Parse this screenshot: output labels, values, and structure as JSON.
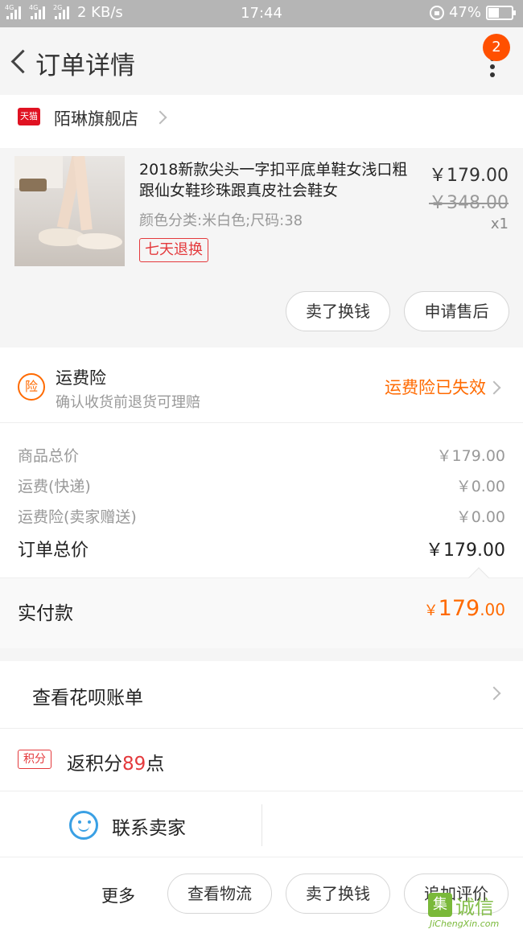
{
  "status_bar": {
    "network1": "4G",
    "network2": "4G",
    "network3": "2G",
    "speed": "2 KB/s",
    "time": "17:44",
    "battery": "47%",
    "battery_level": 0.47
  },
  "nav": {
    "title": "订单详情",
    "badge": "2"
  },
  "shop": {
    "logo_text": "天猫",
    "name": "陌琳旗舰店"
  },
  "product": {
    "title": "2018新款尖头一字扣平底单鞋女浅口粗跟仙女鞋珍珠跟真皮社会鞋女",
    "sku": "颜色分类:米白色;尺码:38",
    "tag": "七天退换",
    "price": "￥179.00",
    "original_price": "￥348.00",
    "quantity": "x1",
    "actions": [
      "卖了换钱",
      "申请售后"
    ]
  },
  "insurance": {
    "icon_text": "险",
    "title": "运费险",
    "subtitle": "确认收货前退货可理赔",
    "status": "运费险已失效"
  },
  "summary": {
    "rows": [
      {
        "label": "商品总价",
        "value": "￥179.00"
      },
      {
        "label": "运费(快递)",
        "value": "￥0.00"
      },
      {
        "label": "运费险(卖家赠送)",
        "value": "￥0.00"
      }
    ],
    "total_label": "订单总价",
    "total_value": "￥179.00"
  },
  "payment": {
    "label": "实付款",
    "currency": "￥",
    "integer": "179",
    "decimal": ".00"
  },
  "huabei": {
    "label": "查看花呗账单"
  },
  "points": {
    "tag": "积分",
    "prefix": "返积分",
    "number": "89",
    "suffix": "点"
  },
  "contact": {
    "label": "联系卖家"
  },
  "bottom_bar": {
    "more": "更多",
    "buttons": [
      "查看物流",
      "卖了换钱",
      "追加评价"
    ]
  },
  "watermark": {
    "box": "集",
    "cn": "诚信",
    "en": "JiChengXin.com"
  },
  "colors": {
    "accent_orange": "#ff6a00",
    "tmall_red": "#e01222",
    "price_red": "#e4393c",
    "smile_blue": "#3aa0e4"
  }
}
